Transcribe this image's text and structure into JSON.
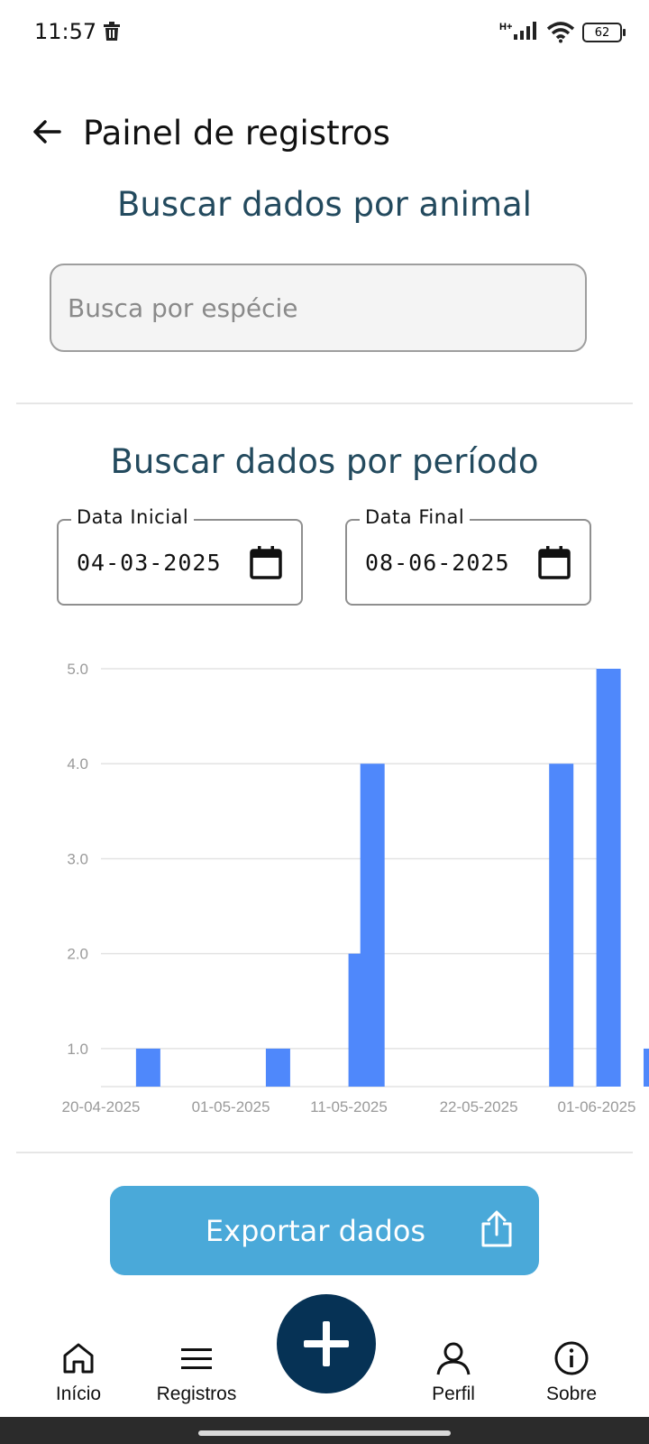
{
  "status_bar": {
    "time": "11:57",
    "network": "H+",
    "battery": "62"
  },
  "header": {
    "title": "Painel de registros"
  },
  "animal_search": {
    "title": "Buscar dados por animal",
    "placeholder": "Busca por espécie",
    "value": ""
  },
  "period_search": {
    "title": "Buscar dados por período",
    "start_label": "Data Inicial",
    "start_value": "04-03-2025",
    "end_label": "Data Final",
    "end_value": "08-06-2025"
  },
  "chart_data": {
    "type": "bar",
    "title": "",
    "xlabel": "",
    "ylabel": "",
    "x_axis_type": "date",
    "x_ticks": [
      "20-04-2025",
      "01-05-2025",
      "11-05-2025",
      "22-05-2025",
      "01-06-2025"
    ],
    "y_ticks": [
      "1.0",
      "2.0",
      "3.0",
      "4.0",
      "5.0"
    ],
    "ylim": [
      0.6,
      5.0
    ],
    "grid": true,
    "color": "#4f88fb",
    "points": [
      {
        "date": "2025-04-24",
        "value": 1
      },
      {
        "date": "2025-05-05",
        "value": 1
      },
      {
        "date": "2025-05-12",
        "value": 2
      },
      {
        "date": "2025-05-13",
        "value": 4
      },
      {
        "date": "2025-05-29",
        "value": 4
      },
      {
        "date": "2025-06-02",
        "value": 5
      },
      {
        "date": "2025-06-06",
        "value": 1
      }
    ]
  },
  "export": {
    "label": "Exportar dados"
  },
  "bottom_nav": {
    "items": [
      {
        "label": "Início",
        "icon": "home-icon"
      },
      {
        "label": "Registros",
        "icon": "menu-icon"
      },
      {
        "label": "Perfil",
        "icon": "person-icon"
      },
      {
        "label": "Sobre",
        "icon": "info-icon"
      }
    ],
    "fab_icon": "plus-icon"
  },
  "colors": {
    "heading": "#234a5e",
    "export_button": "#4aa9d9",
    "fab": "#063255"
  }
}
